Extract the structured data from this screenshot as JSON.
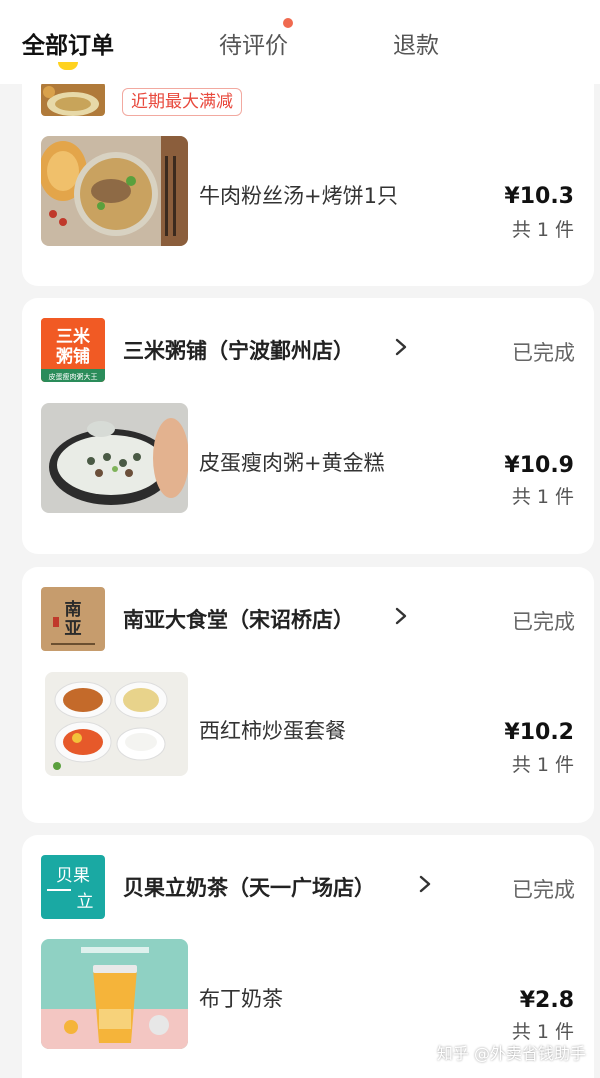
{
  "tabs": [
    {
      "label": "全部订单",
      "active": true
    },
    {
      "label": "待评价",
      "has_dot": true
    },
    {
      "label": "退款"
    }
  ],
  "orders": [
    {
      "promo": "近期最大满减",
      "item": "牛肉粉丝汤+烤饼1只",
      "price": "¥10.3",
      "count": "共 1 件"
    },
    {
      "shop": "三米粥铺（宁波鄞州店）",
      "status": "已完成",
      "logo_text": [
        "三米",
        "粥铺"
      ],
      "logo_sub": "皮蛋瘦肉粥大王",
      "item": "皮蛋瘦肉粥+黄金糕",
      "price": "¥10.9",
      "count": "共 1 件"
    },
    {
      "shop": "南亚大食堂（宋诏桥店）",
      "status": "已完成",
      "logo_text": [
        "南",
        "亚"
      ],
      "item": "西红柿炒蛋套餐",
      "price": "¥10.2",
      "count": "共 1 件"
    },
    {
      "shop": "贝果立奶茶（天一广场店）",
      "status": "已完成",
      "logo_text": [
        "贝果",
        "立"
      ],
      "item": "布丁奶茶",
      "price": "¥2.8",
      "count": "共 1 件"
    }
  ],
  "watermark": "知乎 @外卖省钱助手",
  "colors": {
    "accent": "#ffd21f",
    "promo_red": "#e8493d",
    "logo_orange": "#f15a24",
    "logo_teal": "#1aa9a3"
  }
}
